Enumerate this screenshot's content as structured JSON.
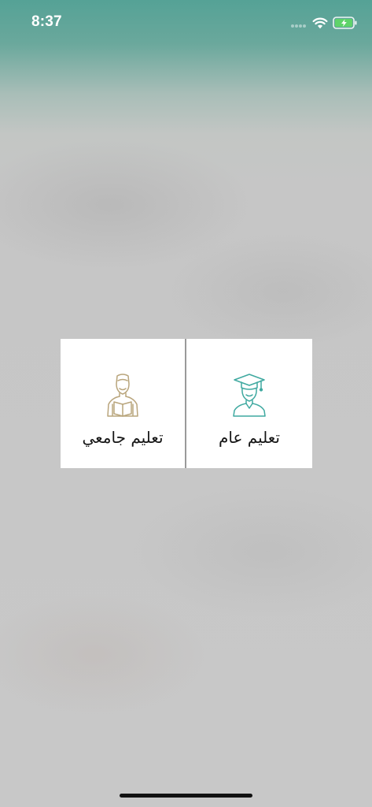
{
  "status_bar": {
    "time": "8:37"
  },
  "options": {
    "university_label": "تعليم جامعي",
    "general_label": "تعليم عام"
  },
  "colors": {
    "header_teal": "#55a296",
    "university_icon": "#b9a57c",
    "general_icon": "#3fa9a0",
    "card_background": "#ffffff"
  },
  "icons": {
    "university": "student-reading-book-icon",
    "general": "graduate-cap-icon",
    "wifi": "wifi-icon",
    "battery": "battery-charging-icon"
  }
}
